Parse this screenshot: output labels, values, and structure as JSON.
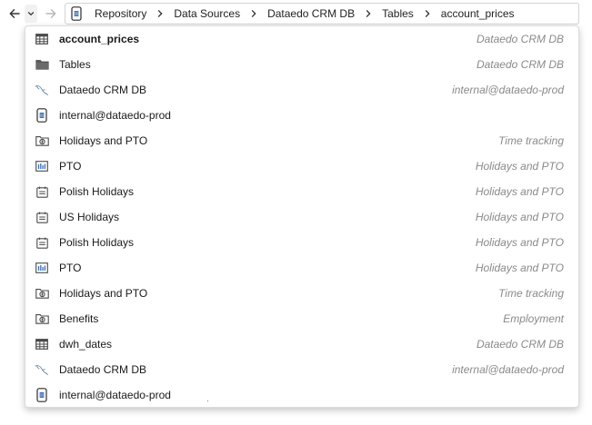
{
  "breadcrumb": {
    "items": [
      "Repository",
      "Data Sources",
      "Dataedo CRM DB",
      "Tables",
      "account_prices"
    ]
  },
  "icons": {
    "back": "arrow-left-icon",
    "history": "chevron-down-icon",
    "forward": "arrow-right-icon",
    "separator": "chevron-right-icon",
    "root": "database-server-icon"
  },
  "colors": {
    "icon": "#4a4a4a",
    "context_text": "#8a8a8a",
    "border": "#d4d4d4"
  },
  "dropdown": {
    "items": [
      {
        "name": "account_prices",
        "context": "Dataedo CRM DB",
        "icon": "table-icon",
        "bold": true
      },
      {
        "name": "Tables",
        "context": "Dataedo CRM DB",
        "icon": "folder-icon"
      },
      {
        "name": "Dataedo CRM DB",
        "context": "internal@dataedo-prod",
        "icon": "mysql-icon"
      },
      {
        "name": "internal@dataedo-prod",
        "context": "",
        "icon": "database-server-icon"
      },
      {
        "name": "Holidays and PTO",
        "context": "Time tracking",
        "icon": "folder-camera-icon"
      },
      {
        "name": "PTO",
        "context": "Holidays and PTO",
        "icon": "chart-icon"
      },
      {
        "name": "Polish Holidays",
        "context": "Holidays and PTO",
        "icon": "calendar-icon"
      },
      {
        "name": "US Holidays",
        "context": "Holidays and PTO",
        "icon": "calendar-icon"
      },
      {
        "name": "Polish Holidays",
        "context": "Holidays and PTO",
        "icon": "calendar-icon"
      },
      {
        "name": "PTO",
        "context": "Holidays and PTO",
        "icon": "chart-icon"
      },
      {
        "name": "Holidays and PTO",
        "context": "Time tracking",
        "icon": "folder-camera-icon"
      },
      {
        "name": "Benefits",
        "context": "Employment",
        "icon": "folder-camera-icon"
      },
      {
        "name": "dwh_dates",
        "context": "Dataedo CRM DB",
        "icon": "table-icon"
      },
      {
        "name": "Dataedo CRM DB",
        "context": "internal@dataedo-prod",
        "icon": "mysql-icon"
      },
      {
        "name": "internal@dataedo-prod",
        "context": "",
        "icon": "database-server-icon"
      }
    ]
  }
}
